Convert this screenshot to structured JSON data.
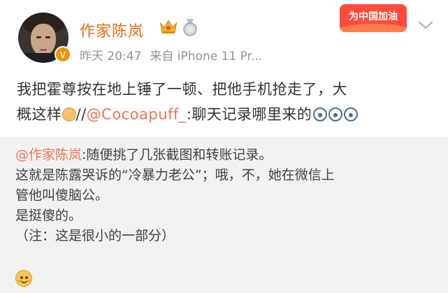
{
  "post": {
    "author": {
      "name": "作家陈岚",
      "verified_badge": "V",
      "crown_icon": "crown-icon",
      "medal_icon": "medal-icon"
    },
    "time": "昨天 20:47",
    "source": "来自 iPhone 11 Pr...",
    "promo_badge": "为中国加油",
    "text": {
      "line1": "我把霍尊按在地上锤了一顿、把他手机抢走了，大",
      "line2_start": "概这样",
      "separator": "//",
      "mention": "@Cocoapuff_",
      "line2_end": ":聊天记录哪里来的"
    }
  },
  "repost": {
    "mention": "@作家陈岚",
    "line1_rest": ":随便挑了几张截图和转账记录。",
    "line2": "这就是陈露哭诉的“冷暴力老公”；哦，不，她在微信上",
    "line3": "管他叫傻脑公。",
    "line4": "是挺傻的。",
    "line5": "（注：这是很小的一部分）"
  },
  "colors": {
    "username": "#e86b0f",
    "link": "#eb7350",
    "meta": "#939393",
    "repost_bg": "#f2f2f2",
    "promo": "#ff4a3c"
  }
}
